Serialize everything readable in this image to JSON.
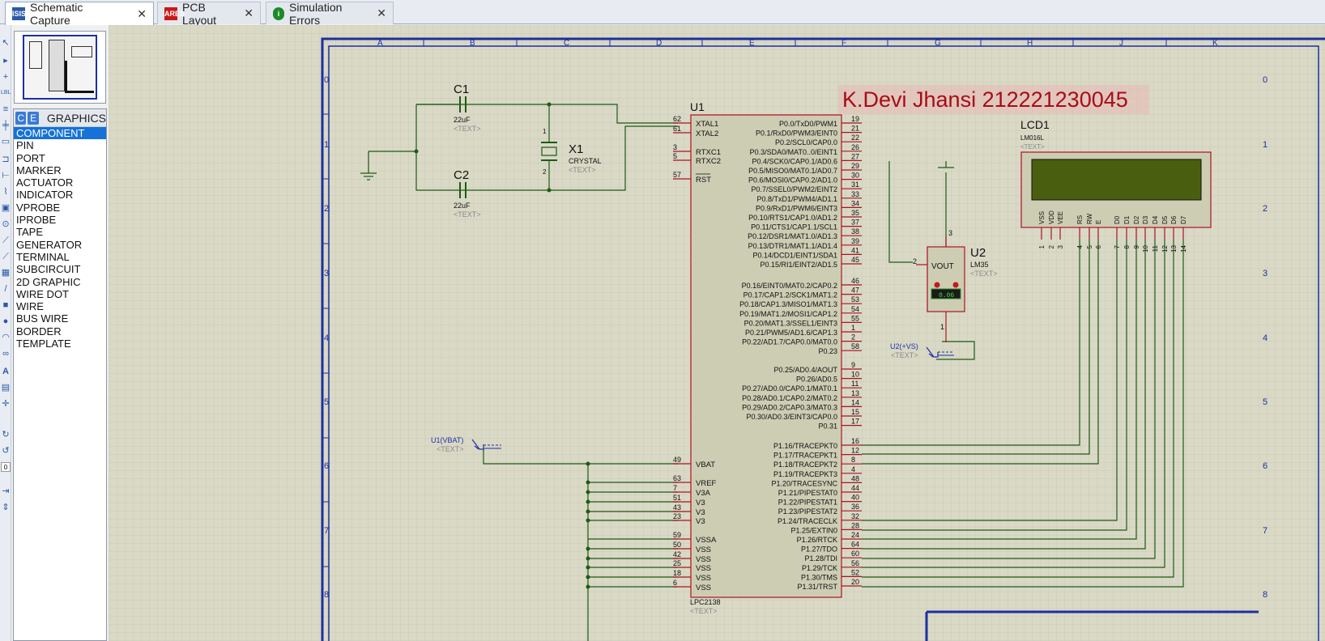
{
  "tabs": [
    {
      "label": "Schematic Capture",
      "icon": "ISIS"
    },
    {
      "label": "PCB Layout",
      "icon": "ARES"
    },
    {
      "label": "Simulation Errors",
      "icon": "i"
    }
  ],
  "picker": {
    "mode_buttons": [
      "C",
      "E"
    ],
    "header": "GRAPHICS",
    "items": [
      "COMPONENT",
      "PIN",
      "PORT",
      "MARKER",
      "ACTUATOR",
      "INDICATOR",
      "VPROBE",
      "IPROBE",
      "TAPE",
      "GENERATOR",
      "TERMINAL",
      "SUBCIRCUIT",
      "2D GRAPHIC",
      "WIRE DOT",
      "WIRE",
      "BUS WIRE",
      "BORDER",
      "TEMPLATE"
    ],
    "selected": "COMPONENT"
  },
  "sheet": {
    "cols": [
      "A",
      "B",
      "C",
      "D",
      "E",
      "F",
      "G",
      "H",
      "J",
      "K"
    ],
    "rows": [
      "0",
      "1",
      "2",
      "3",
      "4",
      "5",
      "6",
      "7",
      "8"
    ]
  },
  "title_text": "K.Devi Jhansi 212221230045",
  "C1": {
    "ref": "C1",
    "value": "22uF",
    "text": "<TEXT>"
  },
  "C2": {
    "ref": "C2",
    "value": "22uF",
    "text": "<TEXT>"
  },
  "X1": {
    "ref": "X1",
    "value": "CRYSTAL",
    "text": "<TEXT>",
    "pin1": "1",
    "pin2": "2"
  },
  "U1": {
    "ref": "U1",
    "part": "LPC2138",
    "text": "<TEXT>",
    "left_pins": [
      {
        "num": "62",
        "name": "XTAL1"
      },
      {
        "num": "61",
        "name": "XTAL2"
      },
      {
        "num": "3",
        "name": "RTXC1"
      },
      {
        "num": "5",
        "name": "RTXC2"
      },
      {
        "num": "57",
        "name": "RST"
      },
      {
        "num": "49",
        "name": "VBAT"
      },
      {
        "num": "63",
        "name": "VREF"
      },
      {
        "num": "7",
        "name": "V3A"
      },
      {
        "num": "51",
        "name": "V3"
      },
      {
        "num": "43",
        "name": "V3"
      },
      {
        "num": "23",
        "name": "V3"
      },
      {
        "num": "59",
        "name": "VSSA"
      },
      {
        "num": "50",
        "name": "VSS"
      },
      {
        "num": "42",
        "name": "VSS"
      },
      {
        "num": "25",
        "name": "VSS"
      },
      {
        "num": "18",
        "name": "VSS"
      },
      {
        "num": "6",
        "name": "VSS"
      }
    ],
    "right_pins": [
      {
        "num": "19",
        "name": "P0.0/TxD0/PWM1"
      },
      {
        "num": "21",
        "name": "P0.1/RxD0/PWM3/EINT0"
      },
      {
        "num": "22",
        "name": "P0.2/SCL0/CAP0.0"
      },
      {
        "num": "26",
        "name": "P0.3/SDA0/MAT0..0/EINT1"
      },
      {
        "num": "27",
        "name": "P0.4/SCK0/CAP0.1/AD0.6"
      },
      {
        "num": "29",
        "name": "P0.5/MISO0/MAT0.1/AD0.7"
      },
      {
        "num": "30",
        "name": "P0.6/MOSI0/CAP0.2/AD1.0"
      },
      {
        "num": "31",
        "name": "P0.7/SSEL0/PWM2/EINT2"
      },
      {
        "num": "33",
        "name": "P0.8/TxD1/PWM4/AD1.1"
      },
      {
        "num": "34",
        "name": "P0.9/RxD1/PWM6/EINT3"
      },
      {
        "num": "35",
        "name": "P0.10/RTS1/CAP1.0/AD1.2"
      },
      {
        "num": "37",
        "name": "P0.11/CTS1/CAP1.1/SCL1"
      },
      {
        "num": "38",
        "name": "P0.12/DSR1/MAT1.0/AD1.3"
      },
      {
        "num": "39",
        "name": "P0.13/DTR1/MAT1.1/AD1.4"
      },
      {
        "num": "41",
        "name": "P0.14/DCD1/EINT1/SDA1"
      },
      {
        "num": "45",
        "name": "P0.15/RI1/EINT2/AD1.5"
      },
      {
        "num": "46",
        "name": "P0.16/EINT0/MAT0.2/CAP0.2"
      },
      {
        "num": "47",
        "name": "P0.17/CAP1.2/SCK1/MAT1.2"
      },
      {
        "num": "53",
        "name": "P0.18/CAP1.3/MISO1/MAT1.3"
      },
      {
        "num": "54",
        "name": "P0.19/MAT1.2/MOSI1/CAP1.2"
      },
      {
        "num": "55",
        "name": "P0.20/MAT1.3/SSEL1/EINT3"
      },
      {
        "num": "1",
        "name": "P0.21/PWM5/AD1.6/CAP1.3"
      },
      {
        "num": "2",
        "name": "P0.22/AD1.7/CAP0.0/MAT0.0"
      },
      {
        "num": "58",
        "name": "P0.23"
      },
      {
        "num": "9",
        "name": "P0.25/AD0.4/AOUT"
      },
      {
        "num": "10",
        "name": "P0.26/AD0.5"
      },
      {
        "num": "11",
        "name": "P0.27/AD0.0/CAP0.1/MAT0.1"
      },
      {
        "num": "13",
        "name": "P0.28/AD0.1/CAP0.2/MAT0.2"
      },
      {
        "num": "14",
        "name": "P0.29/AD0.2/CAP0.3/MAT0.3"
      },
      {
        "num": "15",
        "name": "P0.30/AD0.3/EINT3/CAP0.0"
      },
      {
        "num": "17",
        "name": "P0.31"
      },
      {
        "num": "16",
        "name": "P1.16/TRACEPKT0"
      },
      {
        "num": "12",
        "name": "P1.17/TRACEPKT1"
      },
      {
        "num": "8",
        "name": "P1.18/TRACEPKT2"
      },
      {
        "num": "4",
        "name": "P1.19/TRACEPKT3"
      },
      {
        "num": "48",
        "name": "P1.20/TRACESYNC"
      },
      {
        "num": "44",
        "name": "P1.21/PIPESTAT0"
      },
      {
        "num": "40",
        "name": "P1.22/PIPESTAT1"
      },
      {
        "num": "36",
        "name": "P1.23/PIPESTAT2"
      },
      {
        "num": "32",
        "name": "P1.24/TRACECLK"
      },
      {
        "num": "28",
        "name": "P1.25/EXTIN0"
      },
      {
        "num": "24",
        "name": "P1.26/RTCK"
      },
      {
        "num": "64",
        "name": "P1.27/TDO"
      },
      {
        "num": "60",
        "name": "P1.28/TDI"
      },
      {
        "num": "56",
        "name": "P1.29/TCK"
      },
      {
        "num": "52",
        "name": "P1.30/TMS"
      },
      {
        "num": "20",
        "name": "P1.31/TRST"
      }
    ]
  },
  "U2": {
    "ref": "U2",
    "part": "LM35",
    "text": "<TEXT>",
    "pin_label": "VOUT",
    "display": "0.06",
    "pin_vout": "2",
    "pin_vs": "3",
    "pin_gnd": "1"
  },
  "LCD1": {
    "ref": "LCD1",
    "part": "LM016L",
    "text": "<TEXT>",
    "pin_names": [
      "VSS",
      "VDD",
      "VEE",
      "RS",
      "RW",
      "E",
      "D0",
      "D1",
      "D2",
      "D3",
      "D4",
      "D5",
      "D6",
      "D7"
    ],
    "pin_nums": [
      "1",
      "2",
      "3",
      "4",
      "5",
      "6",
      "7",
      "8",
      "9",
      "10",
      "11",
      "12",
      "13",
      "14"
    ]
  },
  "probe_vbat": {
    "label": "U1(VBAT)",
    "text": "<TEXT>"
  },
  "probe_vs": {
    "label": "U2(+VS)",
    "text": "<TEXT>"
  },
  "colors": {
    "grid_bg": "#d9d9c6",
    "grid_line": "#bfbfae",
    "wire": "#1e5a14",
    "border": "#1c2fa0",
    "component": "#b01020",
    "body": "#cdcdb4",
    "title": "#a80c18",
    "probe": "#2030a8"
  }
}
